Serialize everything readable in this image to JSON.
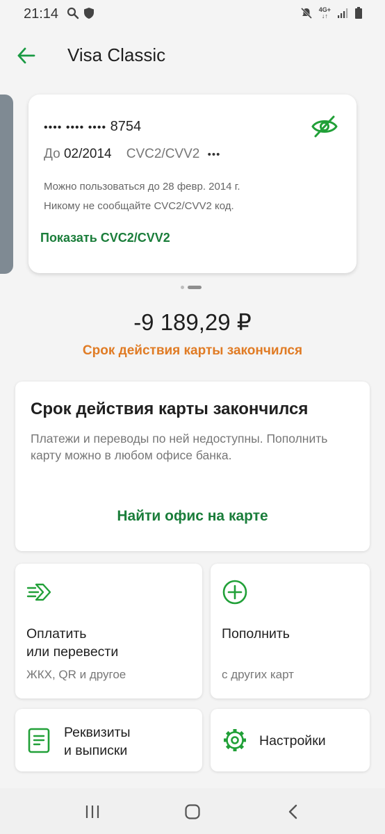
{
  "status": {
    "time": "21:14",
    "network": "4G+"
  },
  "header": {
    "title": "Visa Classic"
  },
  "card": {
    "masked_prefix": "•••• •••• ••••",
    "last4": "8754",
    "exp_prefix": "До",
    "exp_date": "02/2014",
    "cvc_label": "CVC2/CVV2",
    "cvc_masked": "•••",
    "note_validity": "Можно пользоваться до 28 февр. 2014 г.",
    "note_secret": "Никому не сообщайте CVC2/CVV2 код.",
    "show_cvc_label": "Показать CVC2/CVV2"
  },
  "balance": {
    "amount": "-9 189,29 ₽",
    "status": "Срок действия карты закончился"
  },
  "notice": {
    "title": "Срок действия карты закончился",
    "text": "Платежи и переводы по ней недоступны. Пополнить карту можно в любом офисе банка.",
    "link": "Найти офис на карте"
  },
  "actions": {
    "pay": {
      "title": "Оплатить\nили перевести",
      "subtitle": "ЖКХ, QR и другое"
    },
    "topup": {
      "title": "Пополнить",
      "subtitle": "с других карт"
    },
    "details": {
      "title": "Реквизиты\nи выписки"
    },
    "settings": {
      "title": "Настройки"
    }
  },
  "colors": {
    "accent": "#1a7d3a",
    "warning": "#e07b24",
    "icon_green": "#21a038"
  },
  "icons": [
    "search-icon",
    "shield-icon",
    "mute-icon",
    "signal-icon",
    "battery-icon",
    "back-arrow-icon",
    "eye-off-icon",
    "transfer-arrow-icon",
    "plus-circle-icon",
    "document-icon",
    "gear-icon"
  ]
}
